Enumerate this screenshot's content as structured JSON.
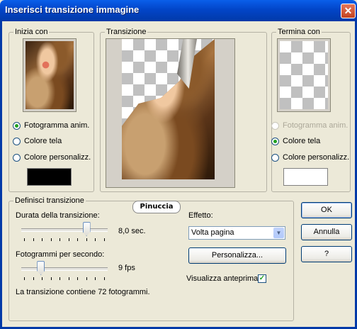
{
  "window": {
    "title": "Inserisci transizione immagine",
    "close_glyph": "✕"
  },
  "start_group": {
    "label": "Inizia con",
    "options": [
      "Fotogramma anim.",
      "Colore tela",
      "Colore personalizz."
    ],
    "selected": 0,
    "custom_color": "#000000"
  },
  "transition_group": {
    "label": "Transizione"
  },
  "end_group": {
    "label": "Termina con",
    "options": [
      "Fotogramma anim.",
      "Colore tela",
      "Colore personalizz."
    ],
    "selected": 1,
    "disabled_index": 0,
    "custom_color": "#FFFFFF"
  },
  "define_group": {
    "label": "Definisci transizione",
    "duration_label": "Durata della transizione:",
    "duration_value": "8,0 sec.",
    "duration_fraction": 0.78,
    "fps_label": "Fotogrammi per secondo:",
    "fps_value": "9 fps",
    "fps_fraction": 0.2,
    "summary": "La transizione contiene 72 fotogrammi.",
    "effect_label": "Effetto:",
    "effect_value": "Volta pagina",
    "customize_label": "Personalizza...",
    "preview_label": "Visualizza anteprima",
    "preview_checked": true,
    "checkmark_glyph": "✓",
    "dropdown_glyph": "▼"
  },
  "buttons": {
    "ok": "OK",
    "cancel": "Annulla",
    "help": "?"
  },
  "watermark": "Pinuccia"
}
